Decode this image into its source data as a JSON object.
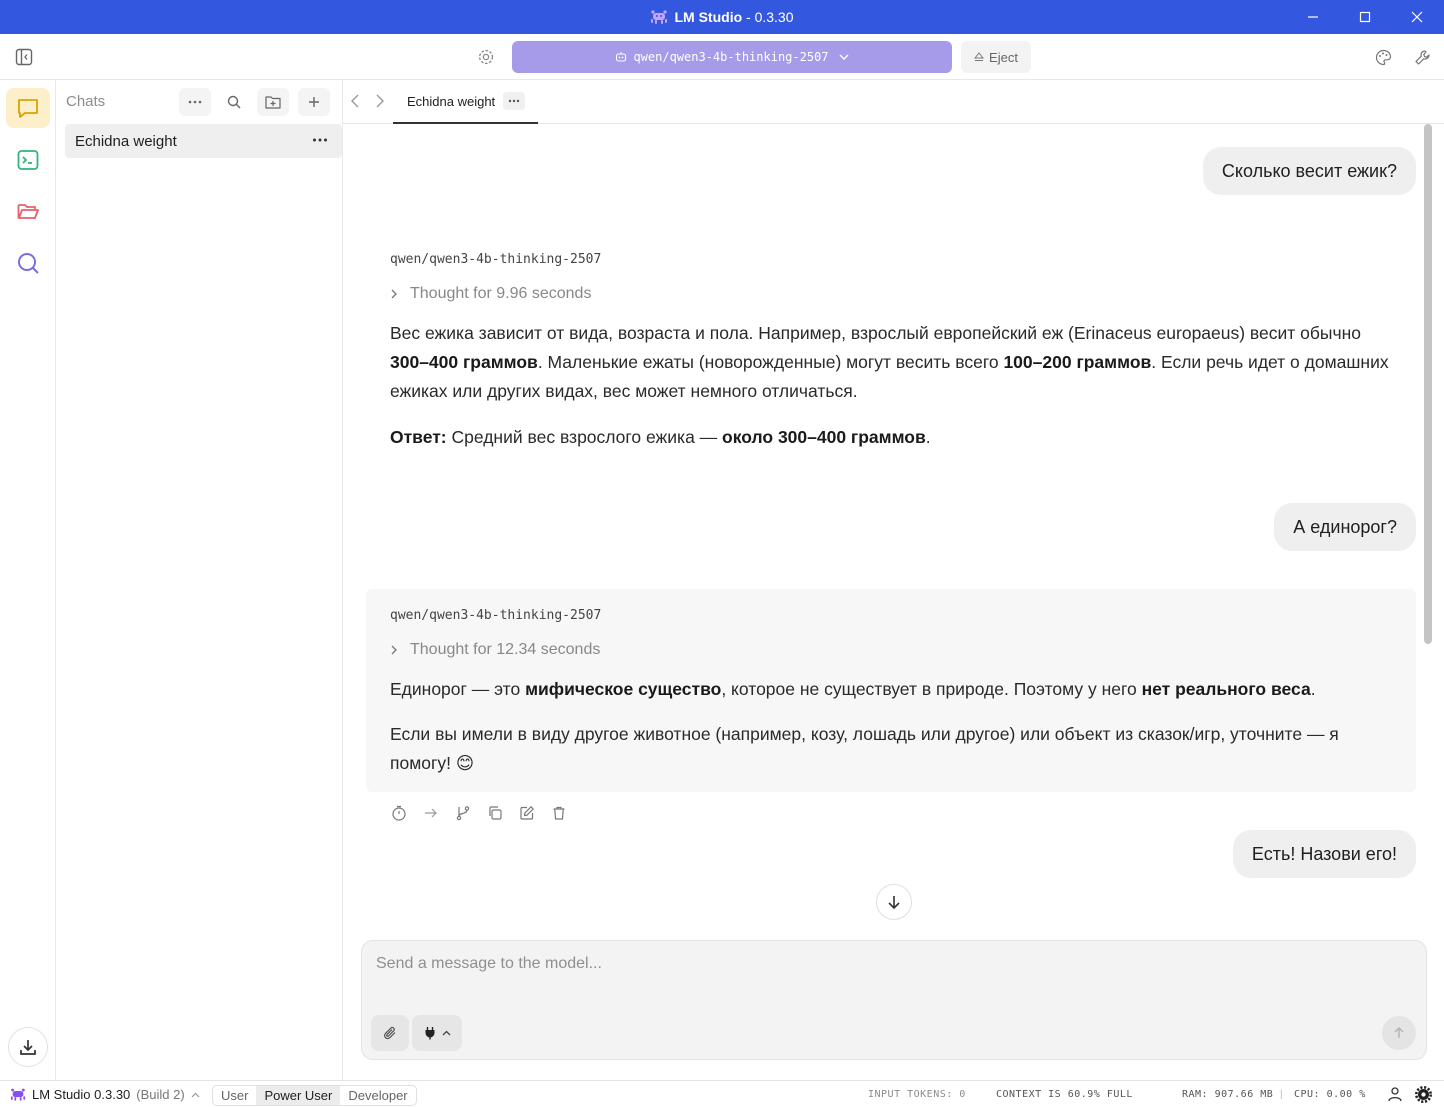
{
  "window": {
    "app_name": "LM Studio",
    "version_suffix": " - 0.3.30"
  },
  "toolbar": {
    "model_name": "qwen/qwen3-4b-thinking-2507",
    "eject_label": "Eject"
  },
  "sidebar": {
    "chats_title": "Chats",
    "chats": [
      {
        "label": "Echidna weight"
      }
    ]
  },
  "tab": {
    "label": "Echidna weight"
  },
  "conversation": {
    "user_1": "Сколько весит ежик?",
    "assistant_1": {
      "model": "qwen/qwen3-4b-thinking-2507",
      "thought": "Thought for 9.96 seconds",
      "p1_a": "Вес ежика зависит от вида, возраста и пола. Например, взрослый европейский еж (Erinaceus europaeus) весит обычно ",
      "p1_b1": "300–400 граммов",
      "p1_c": ". Маленькие ежаты (новорожденные) могут весить всего ",
      "p1_b2": "100–200 граммов",
      "p1_d": ". Если речь идет о домашних ежиках или других видах, вес может немного отличаться.",
      "p2_label": "Ответ:",
      "p2_a": " Средний вес взрослого ежика — ",
      "p2_b": "около 300–400 граммов",
      "p2_c": "."
    },
    "user_2": "А единорог?",
    "assistant_2": {
      "model": "qwen/qwen3-4b-thinking-2507",
      "thought": "Thought for 12.34 seconds",
      "p1_a": "Единорог — это ",
      "p1_b1": "мифическое существо",
      "p1_c": ", которое не существует в природе. Поэтому у него ",
      "p1_b2": "нет реального веса",
      "p1_d": ".",
      "p2": "Если вы имели в виду другое животное (например, козу, лошадь или другое) или объект из сказок/игр, уточните — я помогу! 😊"
    },
    "user_3": "Есть! Назови его!"
  },
  "composer": {
    "placeholder": "Send a message to the model..."
  },
  "statusbar": {
    "app": "LM Studio 0.3.30",
    "build": "(Build 2)",
    "modes": [
      "User",
      "Power User",
      "Developer"
    ],
    "selected_mode": "Power User",
    "input_tokens": "INPUT TOKENS:  0",
    "context": "CONTEXT IS 60.9% FULL",
    "ram": "RAM: 907.66 MB",
    "cpu": "CPU: 0.00 %"
  },
  "colors": {
    "titlebar": "#3457e0",
    "model_pill": "#a59be8",
    "active_rail": "#fcefc9"
  }
}
